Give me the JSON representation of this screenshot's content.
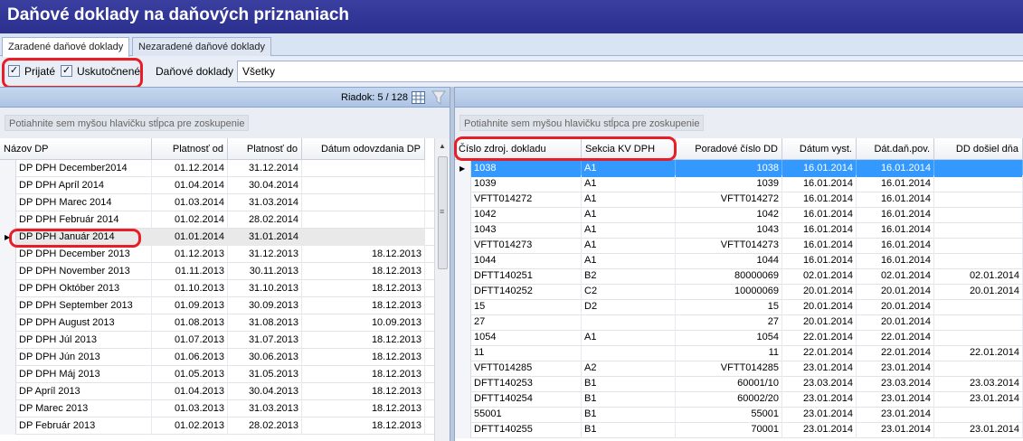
{
  "window_title": "Daňové doklady na daňových priznaniach",
  "tabs": [
    "Zaradené daňové doklady",
    "Nezaradené daňové doklady"
  ],
  "filters": {
    "prijate_label": "Prijaté",
    "uskutocnene_label": "Uskutočnené",
    "checkmark": "✓",
    "danove_doklady_label": "Daňové doklady",
    "danove_doklady_value": "Všetky"
  },
  "left": {
    "row_counter": "Riadok: 5 / 128",
    "group_hint": "Potiahnite sem myšou hlavičku stĺpca pre zoskupenie",
    "columns": [
      "Názov DP",
      "Platnosť od",
      "Platnosť do",
      "Dátum odovzdania DP"
    ],
    "rows": [
      [
        "DP DPH December2014",
        "01.12.2014",
        "31.12.2014",
        ""
      ],
      [
        "DP DPH Apríl 2014",
        "01.04.2014",
        "30.04.2014",
        ""
      ],
      [
        "DP DPH Marec 2014",
        "01.03.2014",
        "31.03.2014",
        ""
      ],
      [
        "DP DPH Február 2014",
        "01.02.2014",
        "28.02.2014",
        ""
      ],
      [
        "DP DPH Január 2014",
        "01.01.2014",
        "31.01.2014",
        ""
      ],
      [
        "DP DPH December 2013",
        "01.12.2013",
        "31.12.2013",
        "18.12.2013"
      ],
      [
        "DP DPH November 2013",
        "01.11.2013",
        "30.11.2013",
        "18.12.2013"
      ],
      [
        "DP DPH Október 2013",
        "01.10.2013",
        "31.10.2013",
        "18.12.2013"
      ],
      [
        "DP DPH September 2013",
        "01.09.2013",
        "30.09.2013",
        "18.12.2013"
      ],
      [
        "DP DPH August 2013",
        "01.08.2013",
        "31.08.2013",
        "10.09.2013"
      ],
      [
        "DP DPH Júl 2013",
        "01.07.2013",
        "31.07.2013",
        "18.12.2013"
      ],
      [
        "DP DPH Jún 2013",
        "01.06.2013",
        "30.06.2013",
        "18.12.2013"
      ],
      [
        "DP DPH Máj 2013",
        "01.05.2013",
        "31.05.2013",
        "18.12.2013"
      ],
      [
        "DP Apríl 2013",
        "01.04.2013",
        "30.04.2013",
        "18.12.2013"
      ],
      [
        "DP Marec 2013",
        "01.03.2013",
        "31.03.2013",
        "18.12.2013"
      ],
      [
        "DP Február 2013",
        "01.02.2013",
        "28.02.2013",
        "18.12.2013"
      ]
    ]
  },
  "right": {
    "group_hint": "Potiahnite sem myšou hlavičku stĺpca pre zoskupenie",
    "columns": [
      "Číslo zdroj. dokladu",
      "Sekcia KV DPH",
      "Poradové číslo DD",
      "Dátum vyst.",
      "Dát.daň.pov.",
      "DD došiel dňa"
    ],
    "rows": [
      [
        "1038",
        "A1",
        "1038",
        "16.01.2014",
        "16.01.2014",
        ""
      ],
      [
        "1039",
        "A1",
        "1039",
        "16.01.2014",
        "16.01.2014",
        ""
      ],
      [
        "VFTT014272",
        "A1",
        "VFTT014272",
        "16.01.2014",
        "16.01.2014",
        ""
      ],
      [
        "1042",
        "A1",
        "1042",
        "16.01.2014",
        "16.01.2014",
        ""
      ],
      [
        "1043",
        "A1",
        "1043",
        "16.01.2014",
        "16.01.2014",
        ""
      ],
      [
        "VFTT014273",
        "A1",
        "VFTT014273",
        "16.01.2014",
        "16.01.2014",
        ""
      ],
      [
        "1044",
        "A1",
        "1044",
        "16.01.2014",
        "16.01.2014",
        ""
      ],
      [
        "DFTT140251",
        "B2",
        "80000069",
        "02.01.2014",
        "02.01.2014",
        "02.01.2014"
      ],
      [
        "DFTT140252",
        "C2",
        "10000069",
        "20.01.2014",
        "20.01.2014",
        "20.01.2014"
      ],
      [
        "15",
        "D2",
        "15",
        "20.01.2014",
        "20.01.2014",
        ""
      ],
      [
        "27",
        "",
        "27",
        "20.01.2014",
        "20.01.2014",
        ""
      ],
      [
        "1054",
        "A1",
        "1054",
        "22.01.2014",
        "22.01.2014",
        ""
      ],
      [
        "11",
        "",
        "11",
        "22.01.2014",
        "22.01.2014",
        "22.01.2014"
      ],
      [
        "VFTT014285",
        "A2",
        "VFTT014285",
        "23.01.2014",
        "23.01.2014",
        ""
      ],
      [
        "DFTT140253",
        "B1",
        "60001/10",
        "23.03.2014",
        "23.03.2014",
        "23.03.2014"
      ],
      [
        "DFTT140254",
        "B1",
        "60002/20",
        "23.01.2014",
        "23.01.2014",
        "23.01.2014"
      ],
      [
        "55001",
        "B1",
        "55001",
        "23.01.2014",
        "23.01.2014",
        ""
      ],
      [
        "DFTT140255",
        "B1",
        "70001",
        "23.01.2014",
        "23.01.2014",
        "23.01.2014"
      ]
    ]
  },
  "icons": [
    "checkbox-checked-icon",
    "grid-settings-icon",
    "filter-icon",
    "row-pointer-icon",
    "scroll-up-icon",
    "scroll-grip-icon"
  ]
}
